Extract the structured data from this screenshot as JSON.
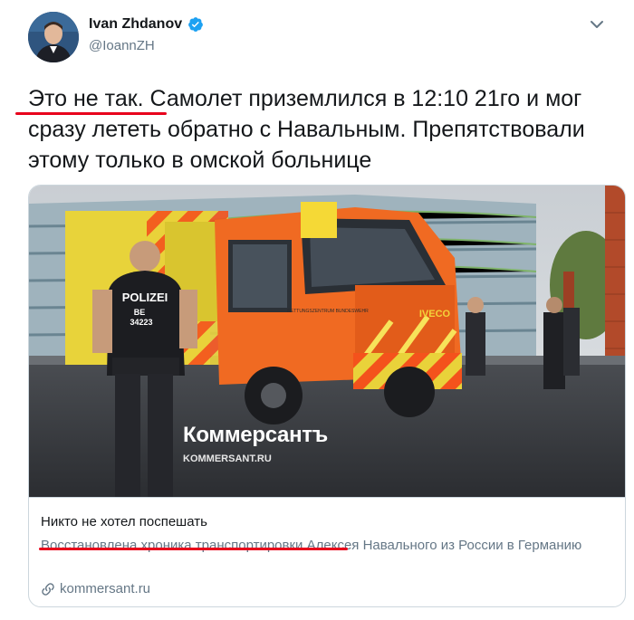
{
  "author": {
    "name": "Ivan Zhdanov",
    "handle": "@IoannZH",
    "verified": true
  },
  "tweet": {
    "text_part1": "Это не так.",
    "text_part2": " Самолет приземлился в 12:10 21го и мог сразу лететь обратно с Навальным. Препятствовали этому только в омской больнице"
  },
  "card": {
    "image_watermark": "Коммерсантъ",
    "image_watermark_url": "KOMMERSANT.RU",
    "image_text": {
      "police_back": "POLIZEI",
      "police_id_line1": "BE",
      "police_id_line2": "34223",
      "truck_brand": "IVECO",
      "truck_label": "RETTUNGSZENTRUM BUNDESWEHR"
    },
    "title": "Никто не хотел поспешать",
    "description_underlined": "Восстановлена хроника транспортировки",
    "description_rest": " Алексея Навального из России в Германию",
    "domain": "kommersant.ru"
  },
  "colors": {
    "accent_blue": "#1da1f2",
    "secondary_text": "#657786",
    "annotation_red": "#e8001c"
  },
  "icons": [
    "verified-badge-icon",
    "chevron-down-icon",
    "link-icon"
  ]
}
